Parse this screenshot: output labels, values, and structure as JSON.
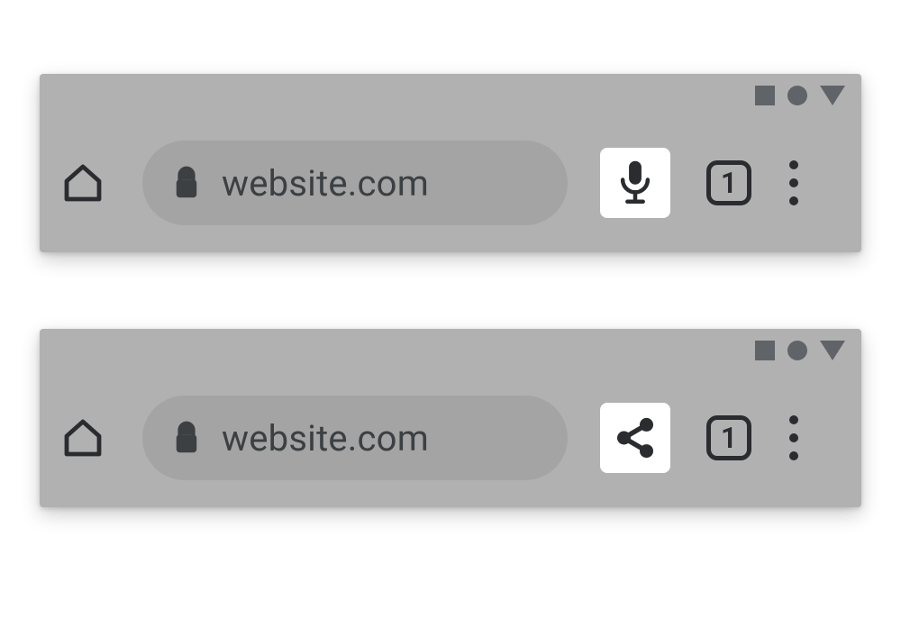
{
  "variants": [
    {
      "status_shapes": [
        "square",
        "circle",
        "triangle"
      ],
      "url": "website.com",
      "tab_count": "1",
      "action_icon": "microphone"
    },
    {
      "status_shapes": [
        "square",
        "circle",
        "triangle"
      ],
      "url": "website.com",
      "tab_count": "1",
      "action_icon": "share"
    }
  ]
}
